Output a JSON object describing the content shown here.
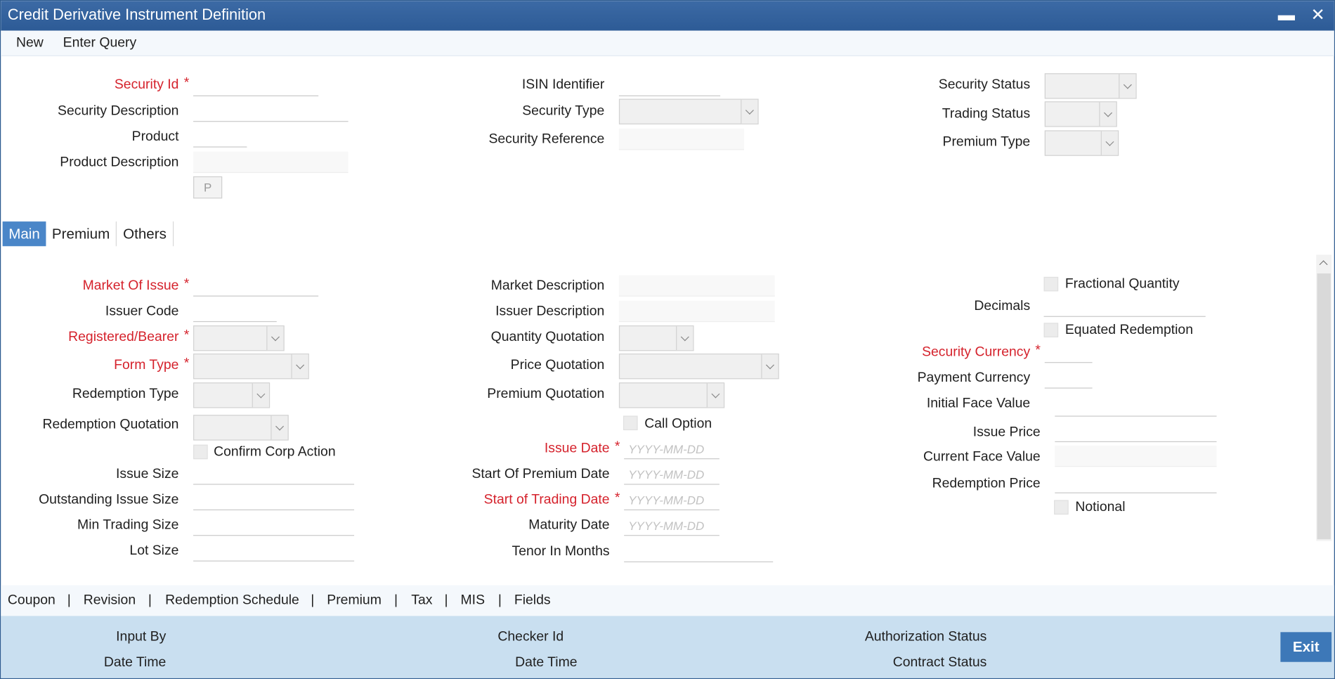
{
  "window": {
    "title": "Credit Derivative Instrument Definition",
    "minimize_icon": "minus-icon",
    "close_icon": "close-icon"
  },
  "menu": {
    "new": "New",
    "enter_query": "Enter Query"
  },
  "header": {
    "security_id": "Security Id",
    "security_description": "Security Description",
    "product": "Product",
    "product_description": "Product Description",
    "p_button": "P",
    "isin_identifier": "ISIN Identifier",
    "security_type": "Security Type",
    "security_reference": "Security Reference",
    "security_status": "Security Status",
    "trading_status": "Trading Status",
    "premium_type": "Premium Type"
  },
  "tabs": [
    "Main",
    "Premium",
    "Others"
  ],
  "main": {
    "market_of_issue": "Market Of Issue",
    "issuer_code": "Issuer Code",
    "registered_bearer": "Registered/Bearer",
    "form_type": "Form Type",
    "redemption_type": "Redemption Type",
    "redemption_quotation": "Redemption Quotation",
    "confirm_corp_action": "Confirm Corp Action",
    "issue_size": "Issue Size",
    "outstanding_issue_size": "Outstanding Issue Size",
    "min_trading_size": "Min Trading Size",
    "lot_size": "Lot Size",
    "market_description": "Market Description",
    "issuer_description": "Issuer Description",
    "quantity_quotation": "Quantity Quotation",
    "price_quotation": "Price Quotation",
    "premium_quotation": "Premium Quotation",
    "call_option": "Call Option",
    "issue_date": "Issue Date",
    "start_of_premium_date": "Start Of Premium Date",
    "start_of_trading_date": "Start of Trading Date",
    "maturity_date": "Maturity Date",
    "tenor_in_months": "Tenor In Months",
    "date_placeholder": "YYYY-MM-DD",
    "fractional_quantity": "Fractional Quantity",
    "decimals": "Decimals",
    "equated_redemption": "Equated Redemption",
    "security_currency": "Security Currency",
    "payment_currency": "Payment Currency",
    "initial_face_value": "Initial Face Value",
    "issue_price": "Issue Price",
    "current_face_value": "Current Face Value",
    "redemption_price": "Redemption Price",
    "notional": "Notional"
  },
  "sublinks": [
    "Coupon",
    "Revision",
    "Redemption Schedule",
    "Premium",
    "Tax",
    "MIS",
    "Fields"
  ],
  "sublink_separator": "|",
  "footer": {
    "input_by": "Input By",
    "date_time": "Date Time",
    "checker_id": "Checker Id",
    "date_time_2": "Date Time",
    "authorization_status": "Authorization Status",
    "contract_status": "Contract Status",
    "exit": "Exit"
  },
  "colors": {
    "title_bar": "#2d5b96",
    "required": "#d5222c",
    "active_tab": "#4a86c8",
    "footer": "#c9dff0",
    "exit_button": "#3d78b8"
  }
}
